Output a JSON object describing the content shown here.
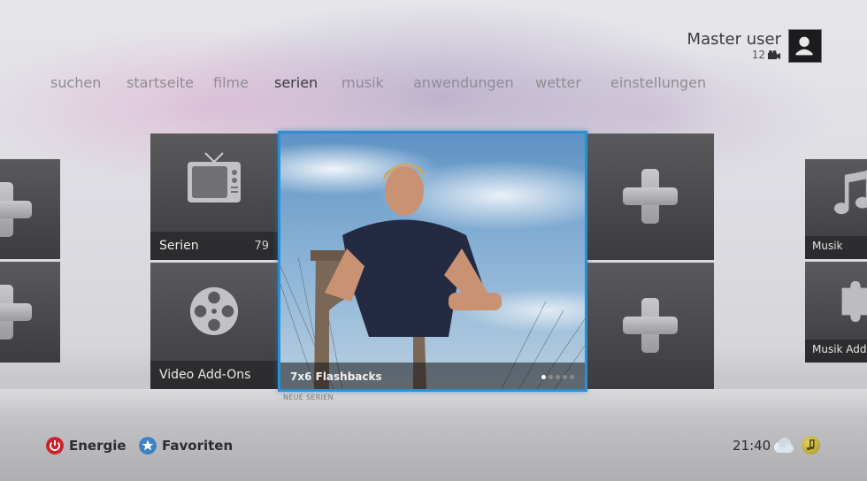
{
  "user": {
    "name": "Master user",
    "count": "12"
  },
  "nav": [
    {
      "label": "suchen",
      "active": false
    },
    {
      "label": "startseite",
      "active": false
    },
    {
      "label": "filme",
      "active": false
    },
    {
      "label": "serien",
      "active": true
    },
    {
      "label": "musik",
      "active": false
    },
    {
      "label": "anwendungen",
      "active": false
    },
    {
      "label": "wetter",
      "active": false
    },
    {
      "label": "einstellungen",
      "active": false
    }
  ],
  "tiles": {
    "serien": {
      "label": "Serien",
      "count": "79"
    },
    "video_addons": {
      "label": "Video Add-Ons"
    },
    "featured": {
      "label": "7x6 Flashbacks",
      "sublabel": "NEUE SERIEN",
      "page_count": 5,
      "current_page": 1
    },
    "musik": {
      "label": "Musik"
    },
    "musik_addons": {
      "label": "Musik Add-o"
    }
  },
  "footer": {
    "energy_label": "Energie",
    "favorites_label": "Favoriten",
    "clock": "21:40"
  },
  "colors": {
    "accent": "#2b8fd0",
    "power": "#c8232a",
    "favorites": "#3b82c4",
    "music_status": "#c7b33c"
  },
  "icons": [
    "tv-icon",
    "film-reel-icon",
    "plus-icon",
    "music-note-icon",
    "puzzle-icon",
    "power-icon",
    "star-icon",
    "weather-icon",
    "music-status-icon",
    "avatar-icon",
    "camera-icon"
  ]
}
